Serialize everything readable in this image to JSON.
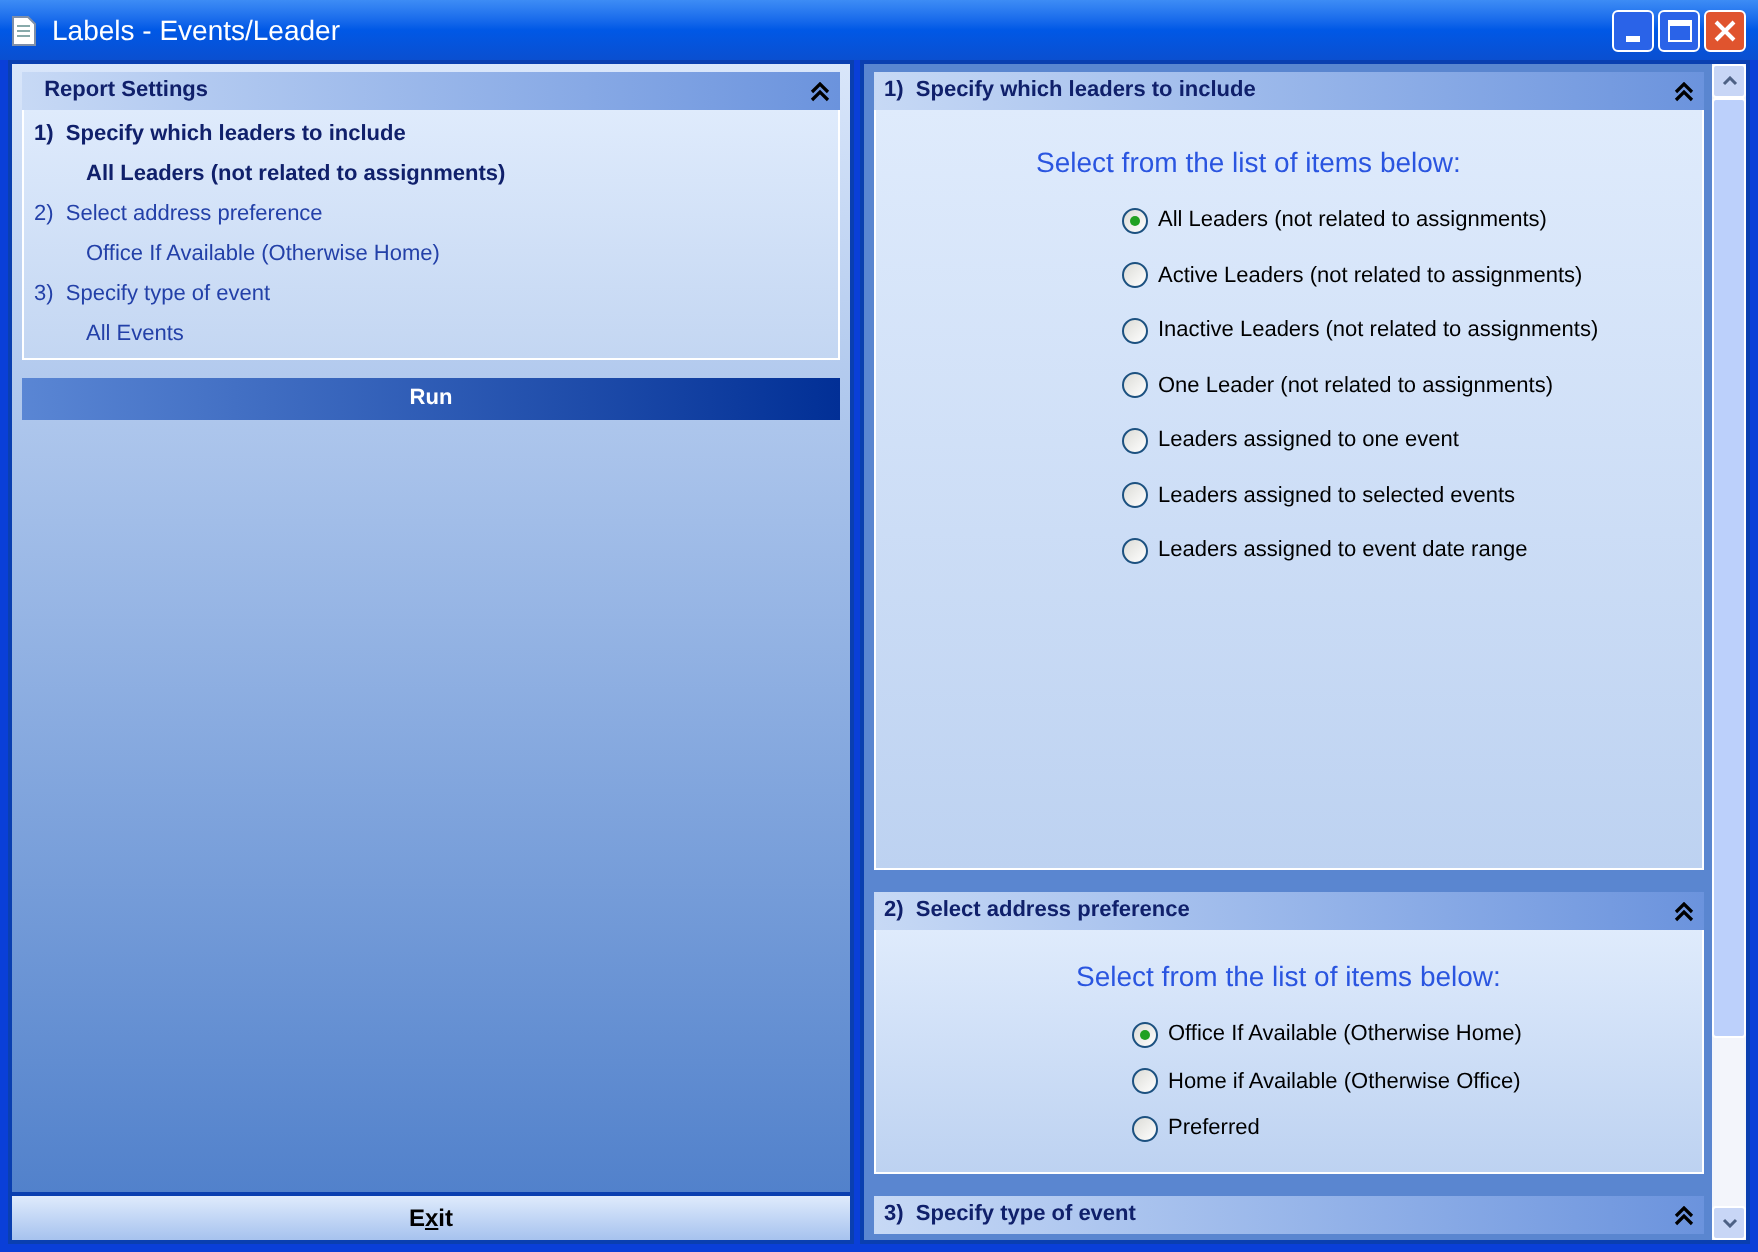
{
  "window": {
    "title": "Labels - Events/Leader"
  },
  "report_settings": {
    "title": "Report Settings",
    "items": [
      {
        "number": "1)",
        "title": "Specify which leaders to include",
        "value": "All Leaders (not related to assignments)",
        "selected": true
      },
      {
        "number": "2)",
        "title": "Select address preference",
        "value": "Office If Available (Otherwise Home)",
        "selected": false
      },
      {
        "number": "3)",
        "title": "Specify type of event",
        "value": "All Events",
        "selected": false
      }
    ]
  },
  "run_button": "Run",
  "exit_button": {
    "label_before": "E",
    "mnemonic": "x",
    "label_after": "it"
  },
  "sections": [
    {
      "number": "1)",
      "title": "Specify which leaders to include",
      "prompt": "Select from the list of items below:",
      "options": [
        {
          "label": "All Leaders (not related to assignments)",
          "selected": true
        },
        {
          "label": "Active Leaders (not related to assignments)",
          "selected": false
        },
        {
          "label": "Inactive Leaders (not related to assignments)",
          "selected": false
        },
        {
          "label": "One Leader (not related to assignments)",
          "selected": false
        },
        {
          "label": "Leaders assigned to one event",
          "selected": false
        },
        {
          "label": "Leaders assigned to selected events",
          "selected": false
        },
        {
          "label": "Leaders assigned to event date range",
          "selected": false
        }
      ]
    },
    {
      "number": "2)",
      "title": "Select address preference",
      "prompt": "Select from the list of items below:",
      "options": [
        {
          "label": "Office If Available (Otherwise Home)",
          "selected": true
        },
        {
          "label": "Home if Available (Otherwise Office)",
          "selected": false
        },
        {
          "label": "Preferred",
          "selected": false
        }
      ]
    },
    {
      "number": "3)",
      "title": "Specify type of event"
    }
  ]
}
